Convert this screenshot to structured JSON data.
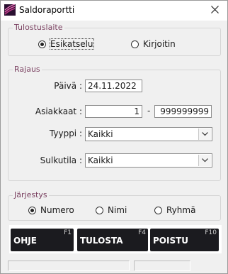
{
  "window": {
    "title": "Saldoraportti",
    "close_icon": "close-icon"
  },
  "output_group": {
    "label": "Tulostuslaite",
    "options": [
      {
        "label": "Esikatselu",
        "selected": true
      },
      {
        "label": "Kirjoitin",
        "selected": false
      }
    ]
  },
  "filter_group": {
    "label": "Rajaus",
    "date_label": "Päivä :",
    "date_value": "24.11.2022",
    "customers_label": "Asiakkaat :",
    "customers_from": "1",
    "range_separator": "-",
    "customers_to": "999999999",
    "type_label": "Tyyppi :",
    "type_value": "Kaikki",
    "blocked_label": "Sulkutila :",
    "blocked_value": "Kaikki"
  },
  "order_group": {
    "label": "Järjestys",
    "options": [
      {
        "label": "Numero",
        "selected": true
      },
      {
        "label": "Nimi",
        "selected": false
      },
      {
        "label": "Ryhmä",
        "selected": false
      }
    ]
  },
  "buttons": [
    {
      "label": "OHJE",
      "key": "F1"
    },
    {
      "label": "TULOSTA",
      "key": "F4"
    },
    {
      "label": "POISTU",
      "key": "F10"
    }
  ],
  "colors": {
    "group_label": "#7a4060",
    "button_bg": "#1b1b1f",
    "window_bg": "#f0f0f0"
  }
}
